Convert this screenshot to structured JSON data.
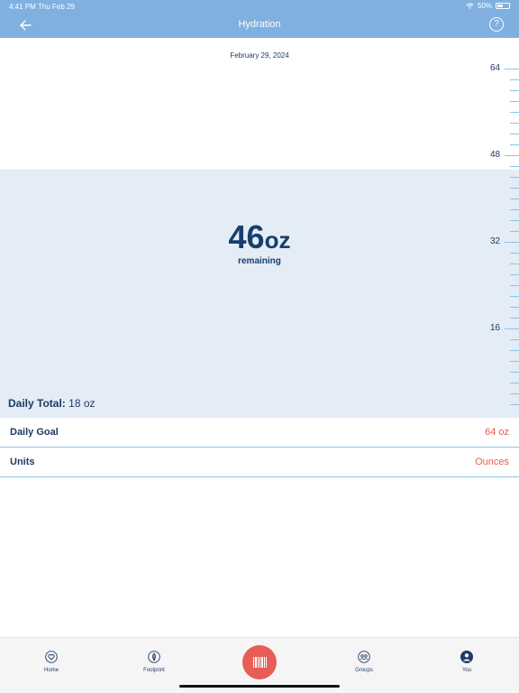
{
  "status_bar": {
    "time": "4:41 PM",
    "date": "Thu Feb 29",
    "battery": "50%"
  },
  "nav": {
    "title": "Hydration",
    "help_glyph": "?"
  },
  "hydration": {
    "date": "February 29, 2024",
    "remaining_value": "46",
    "remaining_unit": "oz",
    "remaining_label": "remaining",
    "daily_total_label": "Daily Total:",
    "daily_total_value": "18 oz",
    "goal_oz": 64,
    "consumed_oz": 18,
    "fill_level_oz": 46,
    "ruler_labels": [
      "64",
      "48",
      "32",
      "16"
    ]
  },
  "settings": {
    "daily_goal_label": "Daily Goal",
    "daily_goal_value": "64 oz",
    "units_label": "Units",
    "units_value": "Ounces"
  },
  "tabs": [
    {
      "label": "Home",
      "icon": "heart-icon"
    },
    {
      "label": "Footprint",
      "icon": "leaf-icon"
    },
    {
      "label": "Groups",
      "icon": "groups-icon"
    },
    {
      "label": "You",
      "icon": "profile-icon"
    }
  ],
  "scan": {
    "icon": "barcode-icon"
  },
  "colors": {
    "accent": "#e85d4f",
    "nav": "#7fb0df",
    "primary": "#173f6e",
    "fill": "#e4ecf6",
    "tick": "#8dc3e6"
  }
}
